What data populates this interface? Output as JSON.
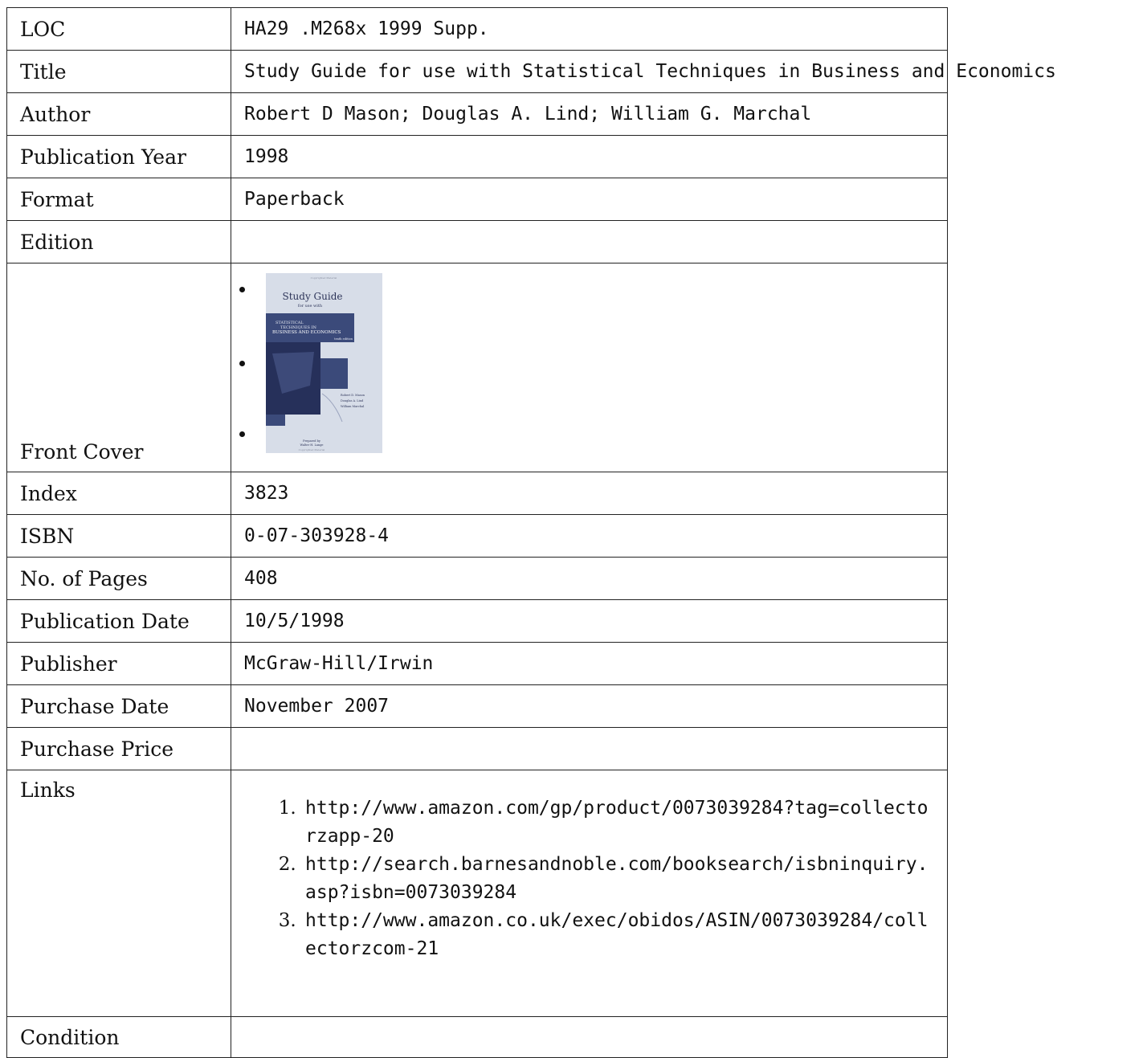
{
  "rows": [
    {
      "label": "LOC",
      "value": "HA29 .M268x 1999 Supp."
    },
    {
      "label": "Title",
      "value": "Study Guide for use with Statistical Techniques in Business and Economics"
    },
    {
      "label": "Author",
      "value": "Robert D Mason; Douglas A. Lind; William G. Marchal"
    },
    {
      "label": "Publication Year",
      "value": "1998"
    },
    {
      "label": "Format",
      "value": "Paperback"
    },
    {
      "label": "Edition",
      "value": ""
    }
  ],
  "cover": {
    "label": "Front Cover",
    "text": {
      "top_note": "Copyrighted Material",
      "title": "Study Guide",
      "subtitle": "for use with",
      "line1": "STATISTICAL",
      "line2": "TECHNIQUES IN",
      "line3": "BUSINESS AND ECONOMICS",
      "edition": "tenth edition",
      "author1": "Robert D. Mason",
      "author2": "Douglas A. Lind",
      "author3": "William Marchal",
      "prepared": "Prepared by",
      "preparer": "Walter H. Lange",
      "bottom_note": "Copyrighted Material"
    },
    "colors": {
      "background": "#d7dde8",
      "panel": "#3b4a7a",
      "panel_dark": "#26305a"
    }
  },
  "rows2": [
    {
      "label": "Index",
      "value": "3823"
    },
    {
      "label": "ISBN",
      "value": "0-07-303928-4"
    },
    {
      "label": "No. of Pages",
      "value": "408"
    },
    {
      "label": "Publication Date",
      "value": "10/5/1998"
    },
    {
      "label": "Publisher",
      "value": "McGraw-Hill/Irwin"
    },
    {
      "label": "Purchase Date",
      "value": "November 2007"
    },
    {
      "label": "Purchase Price",
      "value": ""
    }
  ],
  "links": {
    "label": "Links",
    "items": [
      "http://www.amazon.com/gp/product/0073039284?tag=collectorzapp-20",
      "http://search.barnesandnoble.com/booksearch/isbninquiry.asp?isbn=0073039284",
      "http://www.amazon.co.uk/exec/obidos/ASIN/0073039284/collectorzcom-21"
    ]
  },
  "condition": {
    "label": "Condition",
    "value": ""
  }
}
